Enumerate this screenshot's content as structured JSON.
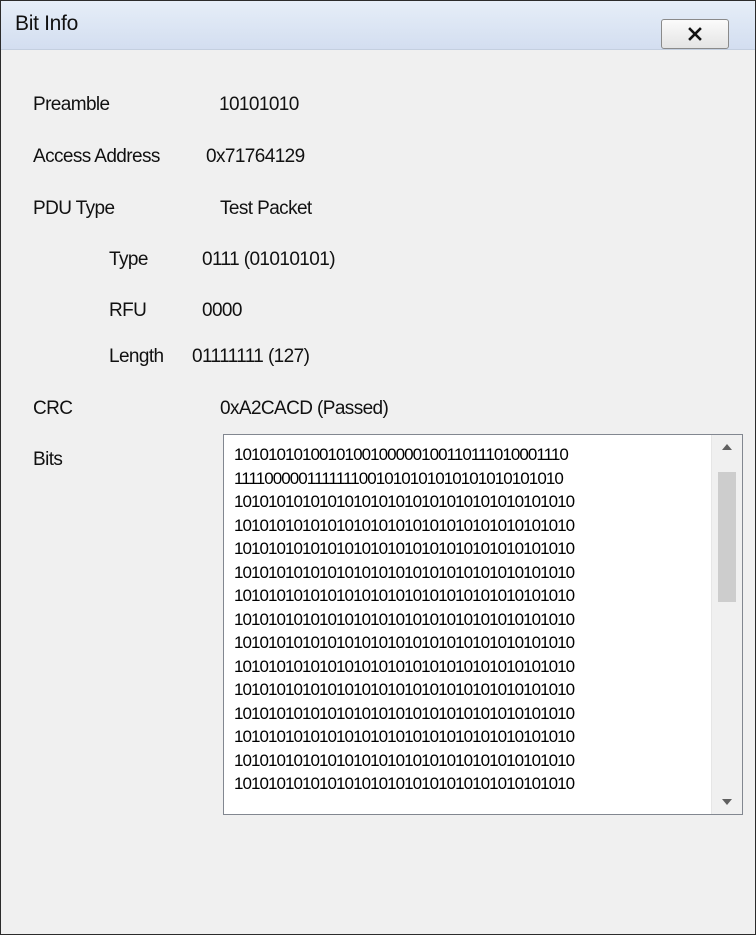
{
  "window": {
    "title": "Bit Info",
    "close_icon": "close-icon"
  },
  "fields": {
    "preamble": {
      "label": "Preamble",
      "value": "10101010"
    },
    "access_address": {
      "label": "Access Address",
      "value": "0x71764129"
    },
    "pdu_type": {
      "label": "PDU Type",
      "value": "Test Packet"
    },
    "type": {
      "label": "Type",
      "value": "0111 (01010101)"
    },
    "rfu": {
      "label": "RFU",
      "value": "0000"
    },
    "length": {
      "label": "Length",
      "value": "01111111 (127)"
    },
    "crc": {
      "label": "CRC",
      "value": "0xA2CACD (Passed)"
    },
    "bits": {
      "label": "Bits"
    }
  },
  "bits_lines": [
    "1010101010010100100000100110111010001110",
    "1111000001111111001010101010101010101010",
    "1010101010101010101010101010101010101010",
    "1010101010101010101010101010101010101010",
    "1010101010101010101010101010101010101010",
    "1010101010101010101010101010101010101010",
    "1010101010101010101010101010101010101010",
    "1010101010101010101010101010101010101010",
    "1010101010101010101010101010101010101010",
    "1010101010101010101010101010101010101010",
    "1010101010101010101010101010101010101010",
    "1010101010101010101010101010101010101010",
    "1010101010101010101010101010101010101010",
    "1010101010101010101010101010101010101010",
    "1010101010101010101010101010101010101010"
  ],
  "scrollbar": {
    "up_icon": "scroll-up-arrow-icon",
    "down_icon": "scroll-down-arrow-icon",
    "position_fraction": 0.0
  }
}
